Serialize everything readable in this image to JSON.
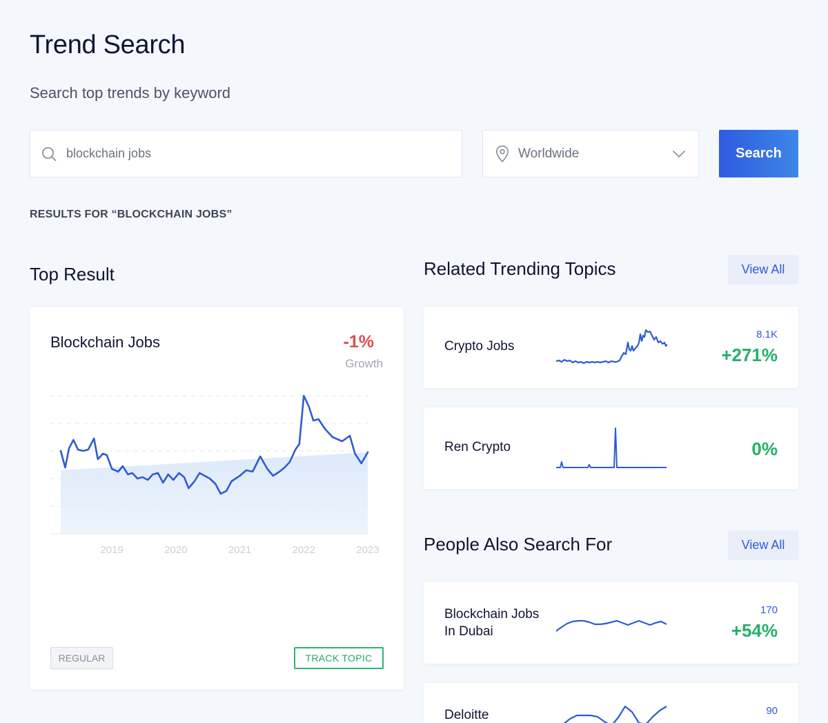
{
  "header": {
    "title": "Trend Search",
    "subtitle": "Search top trends by keyword"
  },
  "search": {
    "value": "blockchain jobs",
    "placeholder": "blockchain jobs",
    "location": "Worldwide",
    "button_label": "Search"
  },
  "results_label": "RESULTS FOR “BLOCKCHAIN JOBS”",
  "top_result": {
    "section_title": "Top Result",
    "name": "Blockchain Jobs",
    "growth": "-1%",
    "growth_label": "Growth",
    "badge": "REGULAR",
    "track_label": "TRACK TOPIC"
  },
  "related": {
    "section_title": "Related Trending Topics",
    "view_all_label": "View All",
    "items": [
      {
        "name": "Crypto Jobs",
        "volume": "8.1K",
        "growth": "+271%"
      },
      {
        "name": "Ren Crypto",
        "volume": "",
        "growth": "0%"
      }
    ]
  },
  "people_also": {
    "section_title": "People Also Search For",
    "view_all_label": "View All",
    "items": [
      {
        "name_line1": "Blockchain Jobs",
        "name_line2": "In Dubai",
        "volume": "170",
        "growth": "+54%"
      },
      {
        "name_line1": "Deloitte",
        "name_line2": "",
        "volume": "90",
        "growth": ""
      }
    ]
  },
  "colors": {
    "accent": "#2f5ad8",
    "line": "#2e5bd3",
    "positive": "#22b067",
    "negative": "#e04e4e"
  },
  "chart_data": {
    "type": "line",
    "x_ticks": [
      "2019",
      "2020",
      "2021",
      "2022",
      "2023"
    ],
    "x_start": 2018.2,
    "x_end": 2023.0,
    "ylim": [
      0,
      100
    ],
    "grid": true,
    "series": [
      {
        "values": [
          [
            2018.2,
            60
          ],
          [
            2018.27,
            48
          ],
          [
            2018.33,
            62
          ],
          [
            2018.4,
            68
          ],
          [
            2018.47,
            61
          ],
          [
            2018.55,
            60
          ],
          [
            2018.63,
            61
          ],
          [
            2018.72,
            69
          ],
          [
            2018.78,
            54
          ],
          [
            2018.86,
            58
          ],
          [
            2018.92,
            57
          ],
          [
            2019.0,
            47
          ],
          [
            2019.1,
            45
          ],
          [
            2019.17,
            49
          ],
          [
            2019.25,
            43
          ],
          [
            2019.32,
            44
          ],
          [
            2019.4,
            40
          ],
          [
            2019.48,
            41
          ],
          [
            2019.56,
            39
          ],
          [
            2019.64,
            43
          ],
          [
            2019.72,
            44
          ],
          [
            2019.8,
            37
          ],
          [
            2019.88,
            43
          ],
          [
            2019.96,
            39
          ],
          [
            2020.05,
            44
          ],
          [
            2020.13,
            41
          ],
          [
            2020.2,
            33
          ],
          [
            2020.29,
            38
          ],
          [
            2020.37,
            44
          ],
          [
            2020.45,
            42
          ],
          [
            2020.53,
            40
          ],
          [
            2020.62,
            36
          ],
          [
            2020.7,
            29
          ],
          [
            2020.79,
            31
          ],
          [
            2020.87,
            38
          ],
          [
            2021.0,
            42
          ],
          [
            2021.1,
            46
          ],
          [
            2021.2,
            45
          ],
          [
            2021.32,
            56
          ],
          [
            2021.43,
            47
          ],
          [
            2021.52,
            42
          ],
          [
            2021.62,
            45
          ],
          [
            2021.7,
            48
          ],
          [
            2021.78,
            52
          ],
          [
            2021.87,
            61
          ],
          [
            2021.93,
            65
          ],
          [
            2022.0,
            100
          ],
          [
            2022.08,
            92
          ],
          [
            2022.15,
            82
          ],
          [
            2022.23,
            83
          ],
          [
            2022.33,
            76
          ],
          [
            2022.45,
            70
          ],
          [
            2022.6,
            67
          ],
          [
            2022.72,
            71
          ],
          [
            2022.8,
            58
          ],
          [
            2022.9,
            51
          ],
          [
            2023.0,
            59
          ]
        ]
      }
    ]
  }
}
